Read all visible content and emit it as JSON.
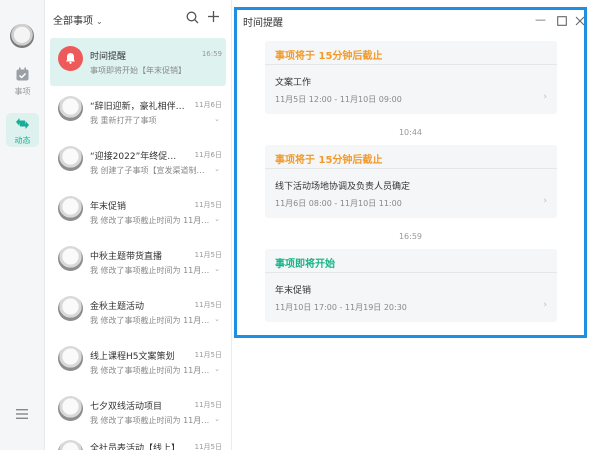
{
  "nav": {
    "items": [
      {
        "label": "事项",
        "icon": "calendar-check-icon"
      },
      {
        "label": "动态",
        "icon": "activity-icon"
      }
    ],
    "active_color": "#1aad96"
  },
  "list": {
    "filter_label": "全部事项",
    "rows": [
      {
        "title": "时间提醒",
        "date": "16:59",
        "subtitle": "事项即将开始【年末促销】"
      },
      {
        "title": "“辞旧迎新，豪礼相伴…",
        "date": "11月6日",
        "subtitle": "我 重新打开了事项"
      },
      {
        "title": "“迎接2022”年终促…",
        "date": "11月6日",
        "subtitle": "我 创建了子事项【宣发渠道制…"
      },
      {
        "title": "年末促销",
        "date": "11月5日",
        "subtitle": "我 修改了事项截止时间为 11月…"
      },
      {
        "title": "中秋主题带货直播",
        "date": "11月5日",
        "subtitle": "我 修改了事项截止时间为 11月…"
      },
      {
        "title": "金秋主题活动",
        "date": "11月5日",
        "subtitle": "我 修改了事项截止时间为 11月…"
      },
      {
        "title": "线上课程H5文案策划",
        "date": "11月5日",
        "subtitle": "我 修改了事项截止时间为 11月…"
      },
      {
        "title": "七夕双线活动项目",
        "date": "11月5日",
        "subtitle": "我 修改了事项截止时间为 11月…"
      },
      {
        "title": "全社员表活动【线上】",
        "date": "11月5日",
        "subtitle": ""
      }
    ]
  },
  "detail": {
    "title": "时间提醒",
    "cards": [
      {
        "header": "事项将于 15分钟后截止",
        "tone": "orange",
        "name": "文案工作",
        "time": "11月5日 12:00 - 11月10日 09:00"
      },
      {
        "header": "事项将于 15分钟后截止",
        "tone": "orange",
        "name": "线下活动场地协调及负责人员确定",
        "time": "11月6日 08:00 - 11月10日 11:00"
      },
      {
        "header": "事项即将开始",
        "tone": "green",
        "name": "年末促销",
        "time": "11月10日 17:00 - 11月19日 20:30"
      }
    ],
    "stamps": [
      "10:44",
      "16:59"
    ],
    "colors": {
      "orange": "#f29b2c",
      "green": "#17b48a",
      "border": "#1f8fe0"
    }
  }
}
